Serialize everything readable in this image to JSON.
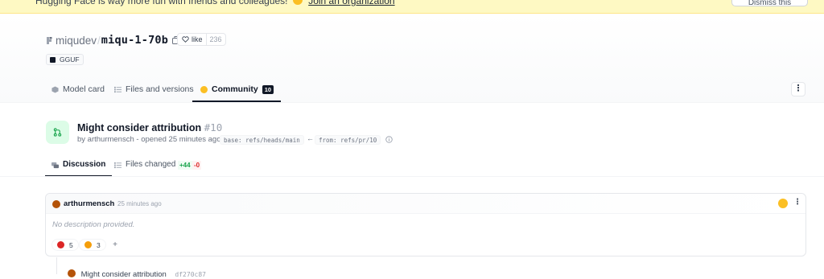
{
  "banner": {
    "text": "Hugging Face is way more fun with friends and colleagues!",
    "link": "Join an organization",
    "dismiss": "Dismiss this message"
  },
  "repo": {
    "owner": "miqudev",
    "separator": "/",
    "name": "miqu-1-70b",
    "like_label": "like",
    "like_count": "236",
    "tag": "GGUF"
  },
  "tabs": [
    {
      "label": "Model card"
    },
    {
      "label": "Files and versions"
    },
    {
      "label": "Community",
      "count": "10"
    }
  ],
  "pr": {
    "title": "Might consider attribution",
    "number": "#10",
    "meta": "by arthurmensch - opened 25 minutes ago",
    "base": "base: refs/heads/main",
    "arrow": "←",
    "from": "from: refs/pr/10"
  },
  "subtabs": [
    {
      "label": "Discussion"
    },
    {
      "label": "Files changed",
      "additions": "+44",
      "deletions": "-0"
    }
  ],
  "comment": {
    "author": "arthurmensch",
    "time": "25 minutes ago",
    "body": "No description provided.",
    "reactions": [
      {
        "icon": "heart-icon",
        "count": "5",
        "color": "#dc2626"
      },
      {
        "icon": "hugging-face-icon",
        "count": "3",
        "color": "#f59e0b"
      }
    ],
    "add_reaction": "+"
  },
  "commit": {
    "title": "Might consider attribution",
    "hash": "df270c87"
  },
  "colors": {
    "banner_bg": "#fef9c3",
    "pr_icon_bg": "#dcfce7",
    "pr_icon_fg": "#16a34a",
    "active_badge": "#111827"
  }
}
